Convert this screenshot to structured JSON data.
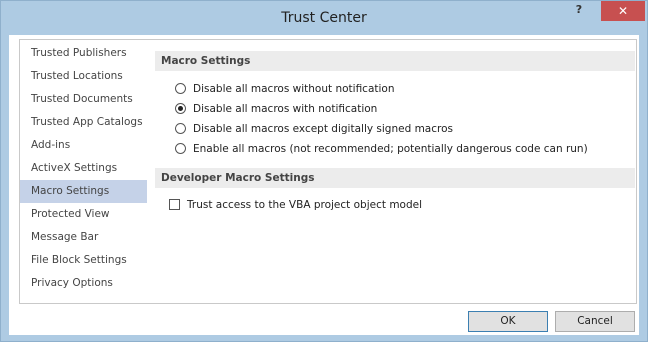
{
  "window": {
    "title": "Trust Center",
    "help_label": "?",
    "close_label": "✕"
  },
  "sidebar": {
    "items": [
      {
        "label": "Trusted Publishers",
        "selected": false
      },
      {
        "label": "Trusted Locations",
        "selected": false
      },
      {
        "label": "Trusted Documents",
        "selected": false
      },
      {
        "label": "Trusted App Catalogs",
        "selected": false
      },
      {
        "label": "Add-ins",
        "selected": false
      },
      {
        "label": "ActiveX Settings",
        "selected": false
      },
      {
        "label": "Macro Settings",
        "selected": true
      },
      {
        "label": "Protected View",
        "selected": false
      },
      {
        "label": "Message Bar",
        "selected": false
      },
      {
        "label": "File Block Settings",
        "selected": false
      },
      {
        "label": "Privacy Options",
        "selected": false
      }
    ]
  },
  "macro_settings": {
    "header": "Macro Settings",
    "options": [
      {
        "label": "Disable all macros without notification",
        "checked": false
      },
      {
        "label": "Disable all macros with notification",
        "checked": true
      },
      {
        "label": "Disable all macros except digitally signed macros",
        "checked": false
      },
      {
        "label": "Enable all macros (not recommended; potentially dangerous code can run)",
        "checked": false
      }
    ]
  },
  "developer_settings": {
    "header": "Developer Macro Settings",
    "trust_vba_label": "Trust access to the VBA project object model",
    "trust_vba_checked": false
  },
  "buttons": {
    "ok_label": "OK",
    "cancel_label": "Cancel"
  }
}
